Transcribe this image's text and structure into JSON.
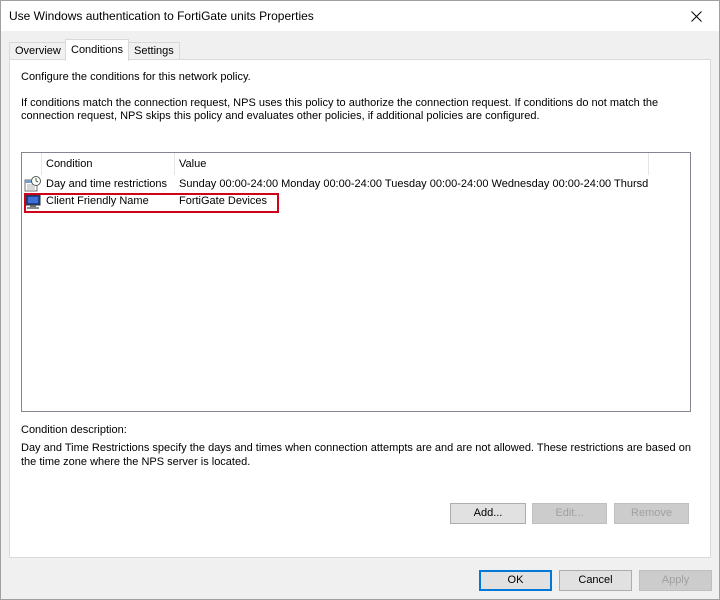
{
  "window": {
    "title": "Use Windows authentication to FortiGate units Properties",
    "close_glyph": "✕"
  },
  "tabs": [
    {
      "label": "Overview"
    },
    {
      "label": "Conditions"
    },
    {
      "label": "Settings"
    }
  ],
  "active_tab": "Conditions",
  "panel": {
    "intro": "Configure the conditions for this network policy.",
    "explanation": "If conditions match the connection request, NPS uses this policy to authorize the connection request. If conditions do not match the connection request, NPS skips this policy and evaluates other policies, if additional policies are configured."
  },
  "conditions_list": {
    "columns": [
      "Condition",
      "Value"
    ],
    "rows": [
      {
        "condition": "Day and time restrictions",
        "value": "Sunday 00:00-24:00 Monday 00:00-24:00 Tuesday 00:00-24:00 Wednesday 00:00-24:00 Thursd...",
        "icon": "clock-calendar-icon"
      },
      {
        "condition": "Client Friendly Name",
        "value": "FortiGate Devices",
        "icon": "computer-monitor-icon"
      }
    ],
    "highlight_color": "#d0021b"
  },
  "condition_description": {
    "label": "Condition description:",
    "text": "Day and Time Restrictions specify the days and times when connection attempts are and are not allowed. These restrictions are based on the time zone where the NPS server is located."
  },
  "condition_buttons": {
    "add": "Add...",
    "edit": "Edit...",
    "remove": "Remove"
  },
  "dialog_buttons": {
    "ok": "OK",
    "cancel": "Cancel",
    "apply": "Apply"
  }
}
